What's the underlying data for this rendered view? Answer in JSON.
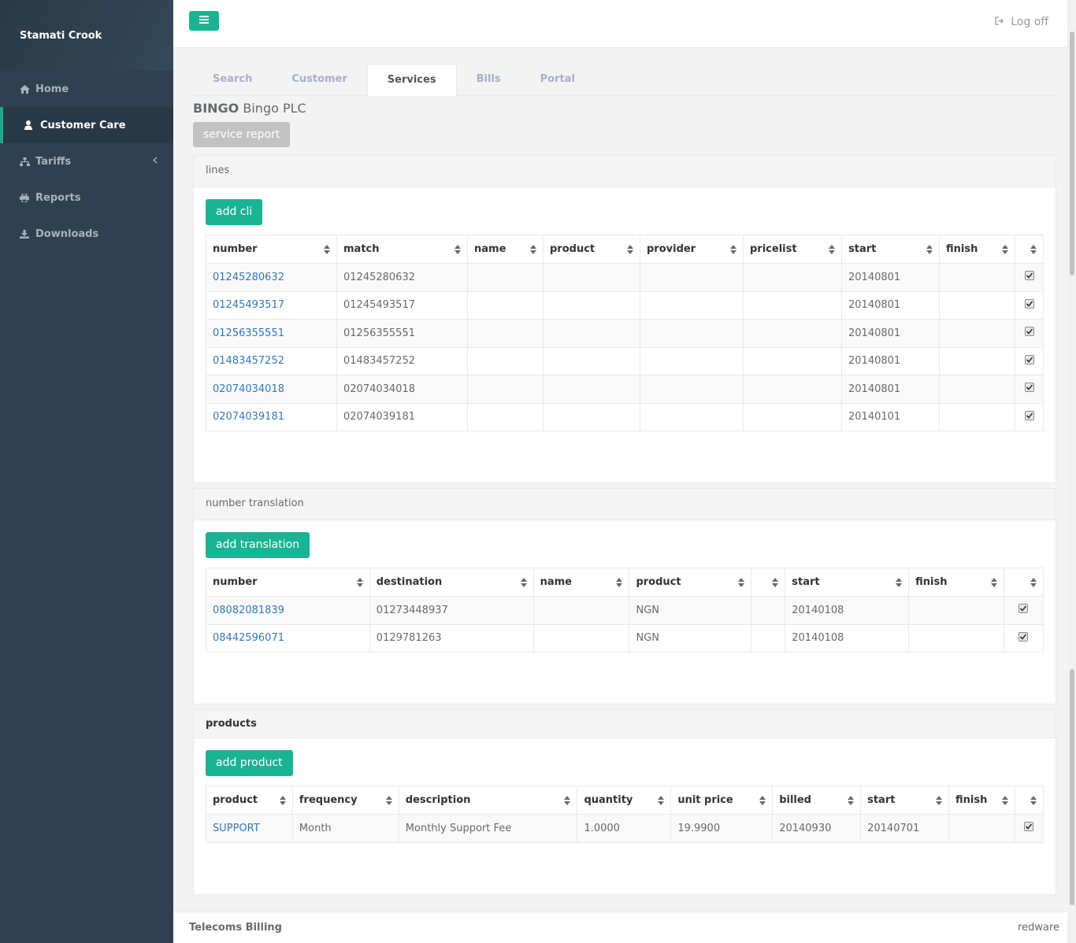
{
  "sidebar": {
    "user_name": "Stamati Crook",
    "items": [
      {
        "label": "Home",
        "icon": "home-icon"
      },
      {
        "label": "Customer Care",
        "icon": "user-icon",
        "active": true
      },
      {
        "label": "Tariffs",
        "icon": "sitemap-icon"
      },
      {
        "label": "Reports",
        "icon": "print-icon"
      },
      {
        "label": "Downloads",
        "icon": "download-icon"
      }
    ]
  },
  "topbar": {
    "logoff_label": "Log off"
  },
  "tabs": [
    "Search",
    "Customer",
    "Services",
    "Bills",
    "Portal"
  ],
  "customer": {
    "code": "BINGO",
    "name": "Bingo PLC"
  },
  "service_report_label": "service report",
  "lines": {
    "title": "lines",
    "add_label": "add cli",
    "columns": [
      "number",
      "match",
      "name",
      "product",
      "provider",
      "pricelist",
      "start",
      "finish",
      ""
    ],
    "rows": [
      {
        "number": "01245280632",
        "match": "01245280632",
        "name": "",
        "product": "",
        "provider": "",
        "pricelist": "",
        "start": "20140801",
        "finish": "",
        "checked": true
      },
      {
        "number": "01245493517",
        "match": "01245493517",
        "name": "",
        "product": "",
        "provider": "",
        "pricelist": "",
        "start": "20140801",
        "finish": "",
        "checked": true
      },
      {
        "number": "01256355551",
        "match": "01256355551",
        "name": "",
        "product": "",
        "provider": "",
        "pricelist": "",
        "start": "20140801",
        "finish": "",
        "checked": true
      },
      {
        "number": "01483457252",
        "match": "01483457252",
        "name": "",
        "product": "",
        "provider": "",
        "pricelist": "",
        "start": "20140801",
        "finish": "",
        "checked": true
      },
      {
        "number": "02074034018",
        "match": "02074034018",
        "name": "",
        "product": "",
        "provider": "",
        "pricelist": "",
        "start": "20140801",
        "finish": "",
        "checked": true
      },
      {
        "number": "02074039181",
        "match": "02074039181",
        "name": "",
        "product": "",
        "provider": "",
        "pricelist": "",
        "start": "20140101",
        "finish": "",
        "checked": true
      }
    ]
  },
  "translation": {
    "title": "number translation",
    "add_label": "add translation",
    "columns": [
      "number",
      "destination",
      "name",
      "product",
      "",
      "start",
      "finish",
      ""
    ],
    "rows": [
      {
        "number": "08082081839",
        "destination": "01273448937",
        "name": "",
        "product": "NGN",
        "extra": "",
        "start": "20140108",
        "finish": "",
        "checked": true
      },
      {
        "number": "08442596071",
        "destination": "0129781263",
        "name": "",
        "product": "NGN",
        "extra": "",
        "start": "20140108",
        "finish": "",
        "checked": true
      }
    ]
  },
  "products": {
    "title": "products",
    "add_label": "add product",
    "columns": [
      "product",
      "frequency",
      "description",
      "quantity",
      "unit price",
      "billed",
      "start",
      "finish",
      ""
    ],
    "rows": [
      {
        "product": "SUPPORT",
        "frequency": "Month",
        "description": "Monthly Support Fee",
        "quantity": "1.0000",
        "unit_price": "19.9900",
        "billed": "20140930",
        "start": "20140701",
        "finish": "",
        "checked": true
      }
    ]
  },
  "footer": {
    "left": "Telecoms Billing",
    "right": "redware"
  },
  "colors": {
    "accent": "#1ab394",
    "sidebar": "#2f4050",
    "link": "#337ab7"
  }
}
